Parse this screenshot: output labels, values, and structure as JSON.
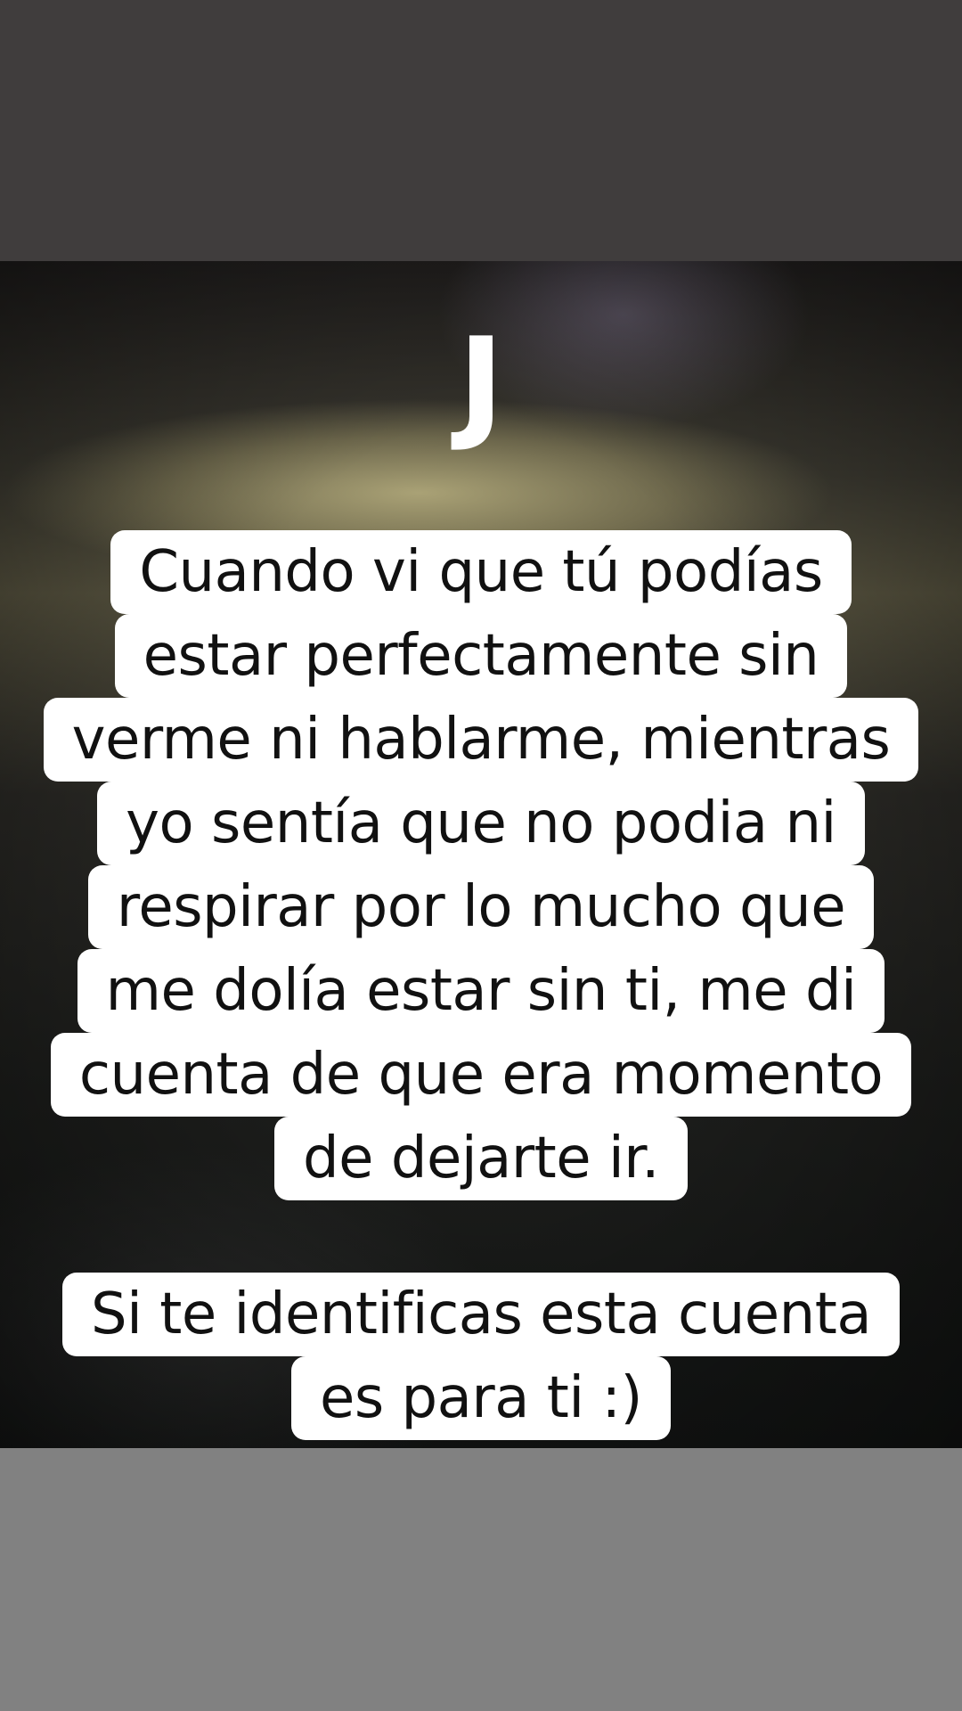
{
  "overlay": {
    "initial": "J",
    "message_lines": [
      "Cuando vi que tú podías",
      "estar perfectamente sin",
      "verme ni hablarme, mientras",
      "yo sentía que no podia ni",
      "respirar por lo mucho que",
      "me dolía estar sin ti, me di",
      "cuenta de que era momento",
      "de dejarte ir."
    ],
    "cta_lines": [
      "Si te identificas esta cuenta",
      "es para ti :)"
    ]
  },
  "colors": {
    "top_band": "#403d3d",
    "bottom_band": "#818181",
    "caption_bg": "#ffffff",
    "caption_text": "#111111",
    "initial_text": "#ffffff"
  }
}
